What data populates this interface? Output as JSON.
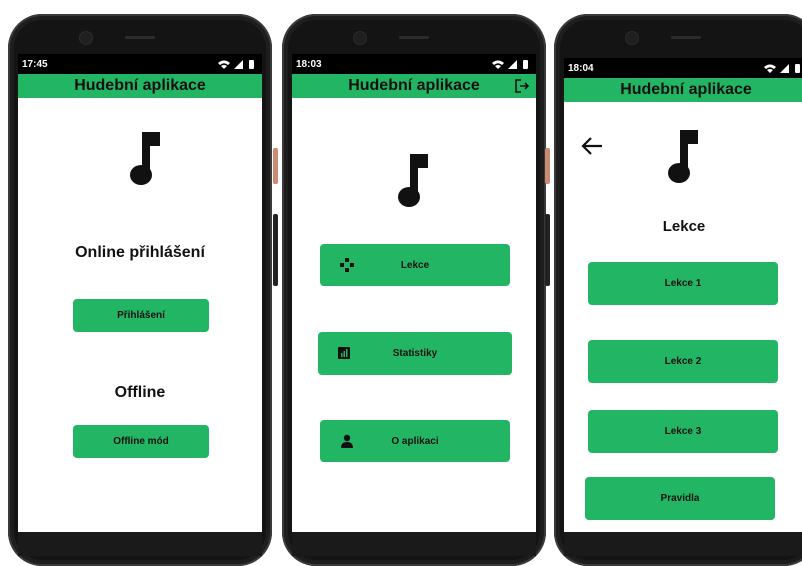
{
  "colors": {
    "accent": "#22b664",
    "statusbar": "#000000",
    "frame": "#1e1e1e"
  },
  "screens": {
    "login": {
      "time": "17:45",
      "title": "Hudební aplikace",
      "online_heading": "Online přihlášení",
      "login_button": "Přihlášení",
      "offline_heading": "Offline",
      "offline_button": "Offline mód"
    },
    "menu": {
      "time": "18:03",
      "title": "Hudební aplikace",
      "items": [
        {
          "label": "Lekce",
          "icon": "gamepad-icon"
        },
        {
          "label": "Statistiky",
          "icon": "stats-icon"
        },
        {
          "label": "O aplikaci",
          "icon": "person-icon"
        }
      ]
    },
    "lessons": {
      "time": "18:04",
      "title": "Hudební aplikace",
      "heading": "Lekce",
      "buttons": [
        "Lekce 1",
        "Lekce 2",
        "Lekce 3",
        "Pravidla"
      ]
    }
  }
}
